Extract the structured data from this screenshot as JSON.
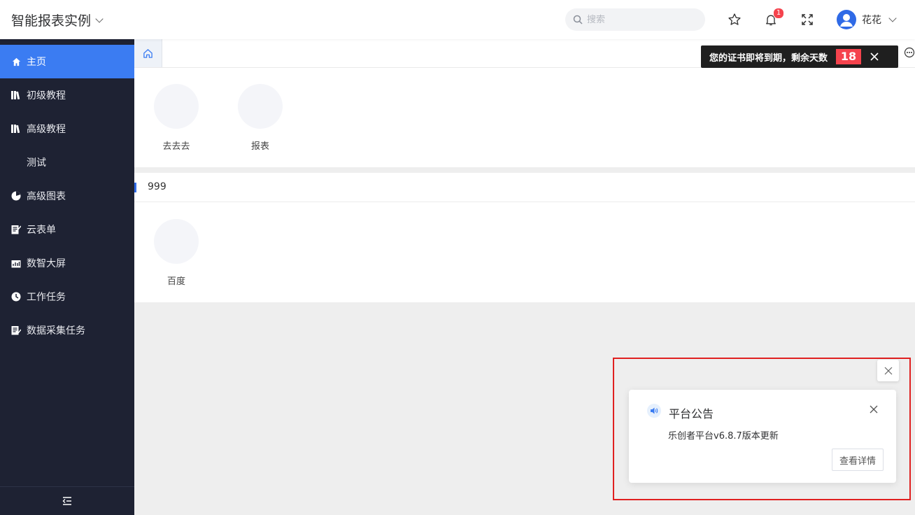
{
  "header": {
    "app_title": "智能报表实例",
    "search_placeholder": "搜索",
    "notification_count": "1",
    "user_name": "花花"
  },
  "sidebar": {
    "items": [
      {
        "label": "主页",
        "icon": "home-icon",
        "active": true
      },
      {
        "label": "初级教程",
        "icon": "books-icon"
      },
      {
        "label": "高级教程",
        "icon": "books-icon"
      },
      {
        "label": "测试",
        "icon": ""
      },
      {
        "label": "高级图表",
        "icon": "pie-chart-icon"
      },
      {
        "label": "云表单",
        "icon": "form-icon"
      },
      {
        "label": "数智大屏",
        "icon": "dashboard-icon"
      },
      {
        "label": "工作任务",
        "icon": "clock-icon"
      },
      {
        "label": "数据采集任务",
        "icon": "edit-doc-icon"
      }
    ]
  },
  "cert_toast": {
    "text": "您的证书即将到期，剩余天数",
    "days": "18"
  },
  "sections": [
    {
      "title": "",
      "apps": [
        "去去去",
        "报表"
      ]
    },
    {
      "title": "999",
      "apps": [
        "百度"
      ]
    }
  ],
  "notice": {
    "title": "平台公告",
    "text": "乐创者平台v6.8.7版本更新",
    "button": "查看详情"
  },
  "colors": {
    "sidebar_bg": "#1e2233",
    "active_item": "#3b7cf2",
    "badge": "#f5434d",
    "highlight_border": "#e02020"
  }
}
